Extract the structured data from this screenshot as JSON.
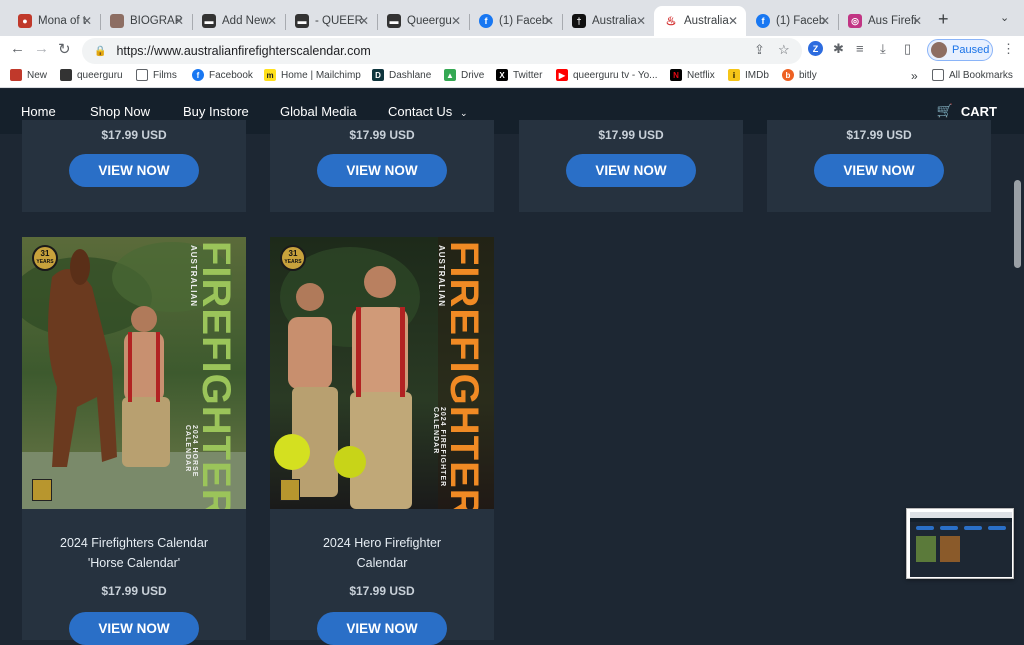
{
  "tabs": [
    {
      "title": "Mona of t",
      "icon": "mona-icon",
      "color": "#c0392b"
    },
    {
      "title": "BIOGRAP",
      "icon": "avatar-icon",
      "color": "#8d6e63"
    },
    {
      "title": "Add New",
      "icon": "queerguru-icon",
      "color": "#333333"
    },
    {
      "title": "- QUEER",
      "icon": "queerguru-icon",
      "color": "#333333"
    },
    {
      "title": "Queergu",
      "icon": "queerguru-icon",
      "color": "#333333"
    },
    {
      "title": "(1) Faceb",
      "icon": "facebook-icon",
      "color": "#1877f2"
    },
    {
      "title": "Australia",
      "icon": "australia-icon",
      "color": "#111111"
    },
    {
      "title": "Australia",
      "icon": "flame-icon",
      "color": "#d32f2f"
    },
    {
      "title": "(1) Faceb",
      "icon": "facebook-icon",
      "color": "#1877f2"
    },
    {
      "title": "Aus Firefi",
      "icon": "instagram-icon",
      "color": "#c13584"
    }
  ],
  "address": {
    "url": "https://www.australianfirefighterscalendar.com"
  },
  "profile": {
    "label": "Paused"
  },
  "bookmarks": [
    {
      "label": "New",
      "icon": "mona-icon",
      "color": "#c0392b"
    },
    {
      "label": "queerguru",
      "icon": "queerguru-icon",
      "color": "#333333"
    },
    {
      "label": "Films",
      "icon": "folder-icon",
      "color": "#5f6368"
    },
    {
      "label": "Facebook",
      "icon": "facebook-icon",
      "color": "#1877f2"
    },
    {
      "label": "Home | Mailchimp",
      "icon": "mailchimp-icon",
      "color": "#ffe01b"
    },
    {
      "label": "Dashlane",
      "icon": "dashlane-icon",
      "color": "#0e353d"
    },
    {
      "label": "Drive",
      "icon": "drive-icon",
      "color": "#34a853"
    },
    {
      "label": "Twitter",
      "icon": "x-icon",
      "color": "#000000"
    },
    {
      "label": "queerguru tv - Yo...",
      "icon": "youtube-icon",
      "color": "#ff0000"
    },
    {
      "label": "Netflix",
      "icon": "netflix-icon",
      "color": "#e50914"
    },
    {
      "label": "IMDb",
      "icon": "imdb-icon",
      "color": "#f5c518"
    },
    {
      "label": "bitly",
      "icon": "bitly-icon",
      "color": "#ee6123"
    }
  ],
  "bookmarks_more": "»",
  "all_bookmarks": "All Bookmarks",
  "nav": {
    "home": "Home",
    "shop_now": "Shop Now",
    "buy_instore": "Buy Instore",
    "global_media": "Global Media",
    "contact_us": "Contact Us",
    "cart": "CART"
  },
  "top_row": [
    {
      "price": "$17.99 USD",
      "button": "VIEW NOW"
    },
    {
      "price": "$17.99 USD",
      "button": "VIEW NOW"
    },
    {
      "price": "$17.99 USD",
      "button": "VIEW NOW"
    },
    {
      "price": "$17.99 USD",
      "button": "VIEW NOW"
    }
  ],
  "products": [
    {
      "title_line1": "2024 Firefighters Calendar",
      "title_line2": "'Horse Calendar'",
      "price": "$17.99 USD",
      "button": "VIEW NOW",
      "cover_years": "31",
      "cover_years_label": "YEARS",
      "cover_title": "FIREFIGHTERS",
      "cover_country": "AUSTRALIAN",
      "cover_sub": "2024 HORSE CALENDAR"
    },
    {
      "title_line1": "2024 Hero Firefighter",
      "title_line2": "Calendar",
      "price": "$17.99 USD",
      "button": "VIEW NOW",
      "cover_years": "31",
      "cover_years_label": "YEARS",
      "cover_title": "FIREFIGHTERS",
      "cover_country": "AUSTRALIAN",
      "cover_sub": "2024 FIREFIGHTER CALENDAR"
    }
  ]
}
